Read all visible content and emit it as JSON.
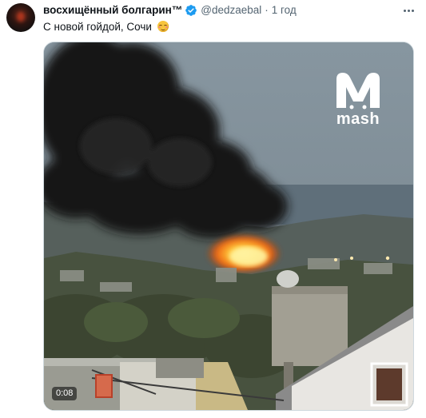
{
  "tweet": {
    "display_name": "восхищённый болгарин™",
    "handle": "@dedzaebal",
    "separator": "·",
    "time": "1 год",
    "text": "С новой гойдой, Сочи",
    "emoji": "smiling-face-with-blush-emoji"
  },
  "media": {
    "watermark": "mash",
    "duration": "0:08"
  },
  "colors": {
    "verified": "#1d9bf0",
    "secondary_text": "#536471",
    "border": "#cfd9de"
  }
}
